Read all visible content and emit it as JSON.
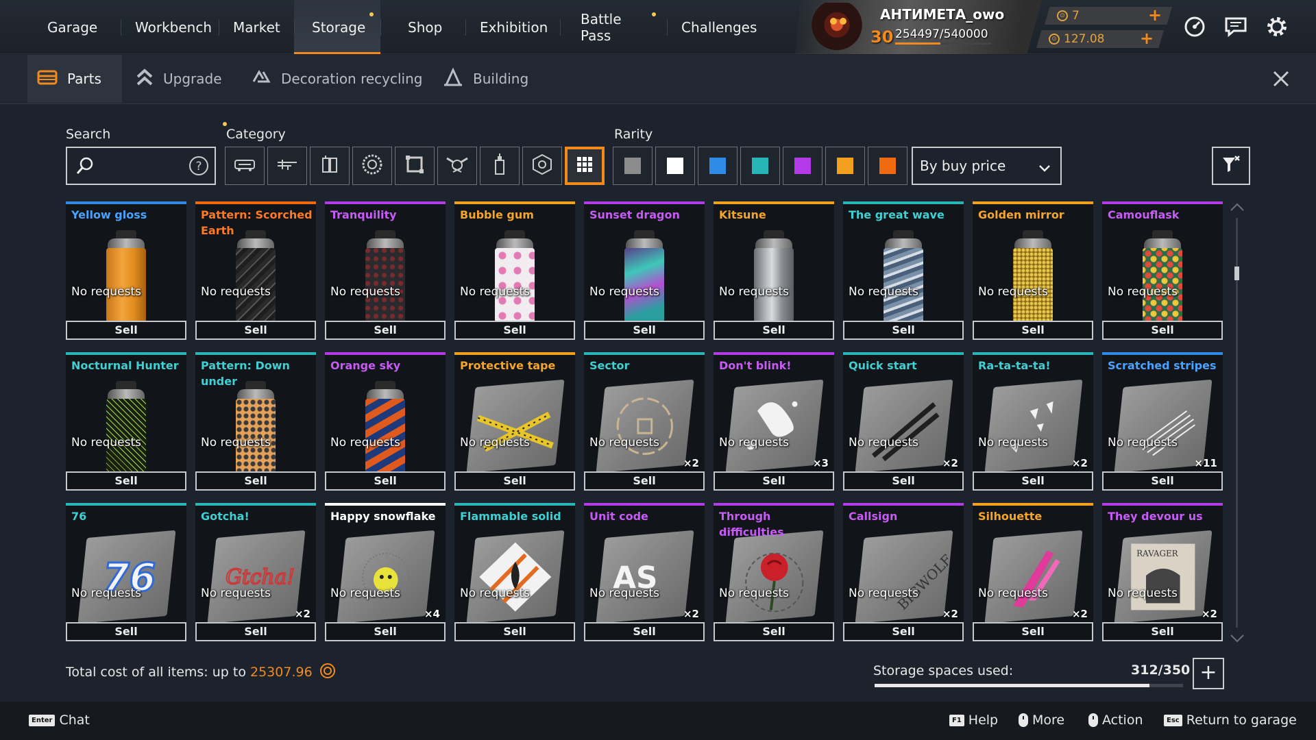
{
  "nav": {
    "tabs": [
      {
        "label": "Garage"
      },
      {
        "label": "Workbench"
      },
      {
        "label": "Market"
      },
      {
        "label": "Storage"
      },
      {
        "label": "Shop"
      },
      {
        "label": "Exhibition"
      },
      {
        "label": "Battle Pass"
      },
      {
        "label": "Challenges"
      }
    ]
  },
  "player": {
    "name": "АНТИМЕТА_owo",
    "level": "30",
    "xp": "254497/540000",
    "xp_progress": 0.47,
    "coins_top": "7",
    "coins_bottom": "127.08"
  },
  "subnav": {
    "tabs": [
      {
        "label": "Parts"
      },
      {
        "label": "Upgrade"
      },
      {
        "label": "Decoration recycling"
      },
      {
        "label": "Building"
      }
    ]
  },
  "filters": {
    "search_label": "Search",
    "category_label": "Category",
    "rarity_label": "Rarity",
    "sort": "By buy price",
    "rarity_colors": [
      "#8c8c8c",
      "#ffffff",
      "#2f8ae8",
      "#27b6b8",
      "#b43ae8",
      "#f2a01e",
      "#f26a10"
    ]
  },
  "items": [
    {
      "name": "Yellow gloss",
      "status": "No requests",
      "sell": "Sell",
      "count": "",
      "rarity_color": "#2f8ae8",
      "name_color": "#4aa3ff"
    },
    {
      "name": "Pattern: Scorched Earth",
      "status": "No requests",
      "sell": "Sell",
      "count": "",
      "rarity_color": "#f26a10",
      "name_color": "#ff7a20"
    },
    {
      "name": "Tranquility",
      "status": "No requests",
      "sell": "Sell",
      "count": "",
      "rarity_color": "#b43ae8",
      "name_color": "#c75cf5"
    },
    {
      "name": "Bubble gum",
      "status": "No requests",
      "sell": "Sell",
      "count": "",
      "rarity_color": "#f2a01e",
      "name_color": "#f5a62a"
    },
    {
      "name": "Sunset dragon",
      "status": "No requests",
      "sell": "Sell",
      "count": "",
      "rarity_color": "#b43ae8",
      "name_color": "#c75cf5"
    },
    {
      "name": "Kitsune",
      "status": "No requests",
      "sell": "Sell",
      "count": "",
      "rarity_color": "#f2a01e",
      "name_color": "#f5a62a"
    },
    {
      "name": "The great wave",
      "status": "No requests",
      "sell": "Sell",
      "count": "",
      "rarity_color": "#27b6b8",
      "name_color": "#3ed0d2"
    },
    {
      "name": "Golden mirror",
      "status": "No requests",
      "sell": "Sell",
      "count": "",
      "rarity_color": "#f2a01e",
      "name_color": "#f5a62a"
    },
    {
      "name": "Camouflask",
      "status": "No requests",
      "sell": "Sell",
      "count": "",
      "rarity_color": "#b43ae8",
      "name_color": "#c75cf5"
    },
    {
      "name": "Nocturnal Hunter",
      "status": "No requests",
      "sell": "Sell",
      "count": "",
      "rarity_color": "#27b6b8",
      "name_color": "#3ed0d2"
    },
    {
      "name": "Pattern: Down under",
      "status": "No requests",
      "sell": "Sell",
      "count": "",
      "rarity_color": "#27b6b8",
      "name_color": "#3ed0d2"
    },
    {
      "name": "Orange sky",
      "status": "No requests",
      "sell": "Sell",
      "count": "",
      "rarity_color": "#b43ae8",
      "name_color": "#c75cf5"
    },
    {
      "name": "Protective tape",
      "status": "No requests",
      "sell": "Sell",
      "count": "",
      "rarity_color": "#f2a01e",
      "name_color": "#f5a62a"
    },
    {
      "name": "Sector",
      "status": "No requests",
      "sell": "Sell",
      "count": "×2",
      "rarity_color": "#27b6b8",
      "name_color": "#3ed0d2"
    },
    {
      "name": "Don't blink!",
      "status": "No requests",
      "sell": "Sell",
      "count": "×3",
      "rarity_color": "#b43ae8",
      "name_color": "#c75cf5"
    },
    {
      "name": "Quick start",
      "status": "No requests",
      "sell": "Sell",
      "count": "×2",
      "rarity_color": "#27b6b8",
      "name_color": "#3ed0d2"
    },
    {
      "name": "Ra-ta-ta-ta!",
      "status": "No requests",
      "sell": "Sell",
      "count": "×2",
      "rarity_color": "#27b6b8",
      "name_color": "#3ed0d2"
    },
    {
      "name": "Scratched stripes",
      "status": "No requests",
      "sell": "Sell",
      "count": "×11",
      "rarity_color": "#2f8ae8",
      "name_color": "#4aa3ff"
    },
    {
      "name": "76",
      "status": "No requests",
      "sell": "Sell",
      "count": "",
      "rarity_color": "#27b6b8",
      "name_color": "#3ed0d2"
    },
    {
      "name": "Gotcha!",
      "status": "No requests",
      "sell": "Sell",
      "count": "×2",
      "rarity_color": "#27b6b8",
      "name_color": "#3ed0d2"
    },
    {
      "name": "Happy snowflake",
      "status": "No requests",
      "sell": "Sell",
      "count": "×4",
      "rarity_color": "#ffffff",
      "name_color": "#ffffff"
    },
    {
      "name": "Flammable solid",
      "status": "No requests",
      "sell": "Sell",
      "count": "",
      "rarity_color": "#27b6b8",
      "name_color": "#3ed0d2"
    },
    {
      "name": "Unit code",
      "status": "No requests",
      "sell": "Sell",
      "count": "×2",
      "rarity_color": "#b43ae8",
      "name_color": "#c75cf5"
    },
    {
      "name": "Through difficulties",
      "status": "No requests",
      "sell": "Sell",
      "count": "",
      "rarity_color": "#b43ae8",
      "name_color": "#c75cf5"
    },
    {
      "name": "Callsign",
      "status": "No requests",
      "sell": "Sell",
      "count": "×2",
      "rarity_color": "#b43ae8",
      "name_color": "#c75cf5"
    },
    {
      "name": "Silhouette",
      "status": "No requests",
      "sell": "Sell",
      "count": "×2",
      "rarity_color": "#f2a01e",
      "name_color": "#f5a62a"
    },
    {
      "name": "They devour us",
      "status": "No requests",
      "sell": "Sell",
      "count": "×2",
      "rarity_color": "#b43ae8",
      "name_color": "#c75cf5"
    }
  ],
  "footer": {
    "total_label": "Total cost of all items: up to",
    "total_value": "25307.96",
    "storage_label": "Storage spaces used:",
    "storage_value": "312/350",
    "storage_fraction": 0.891
  },
  "hints": {
    "chat_key": "Enter",
    "chat": "Chat",
    "help_key": "F1",
    "help": "Help",
    "more": "More",
    "action": "Action",
    "return_key": "Esc",
    "return": "Return to garage"
  }
}
